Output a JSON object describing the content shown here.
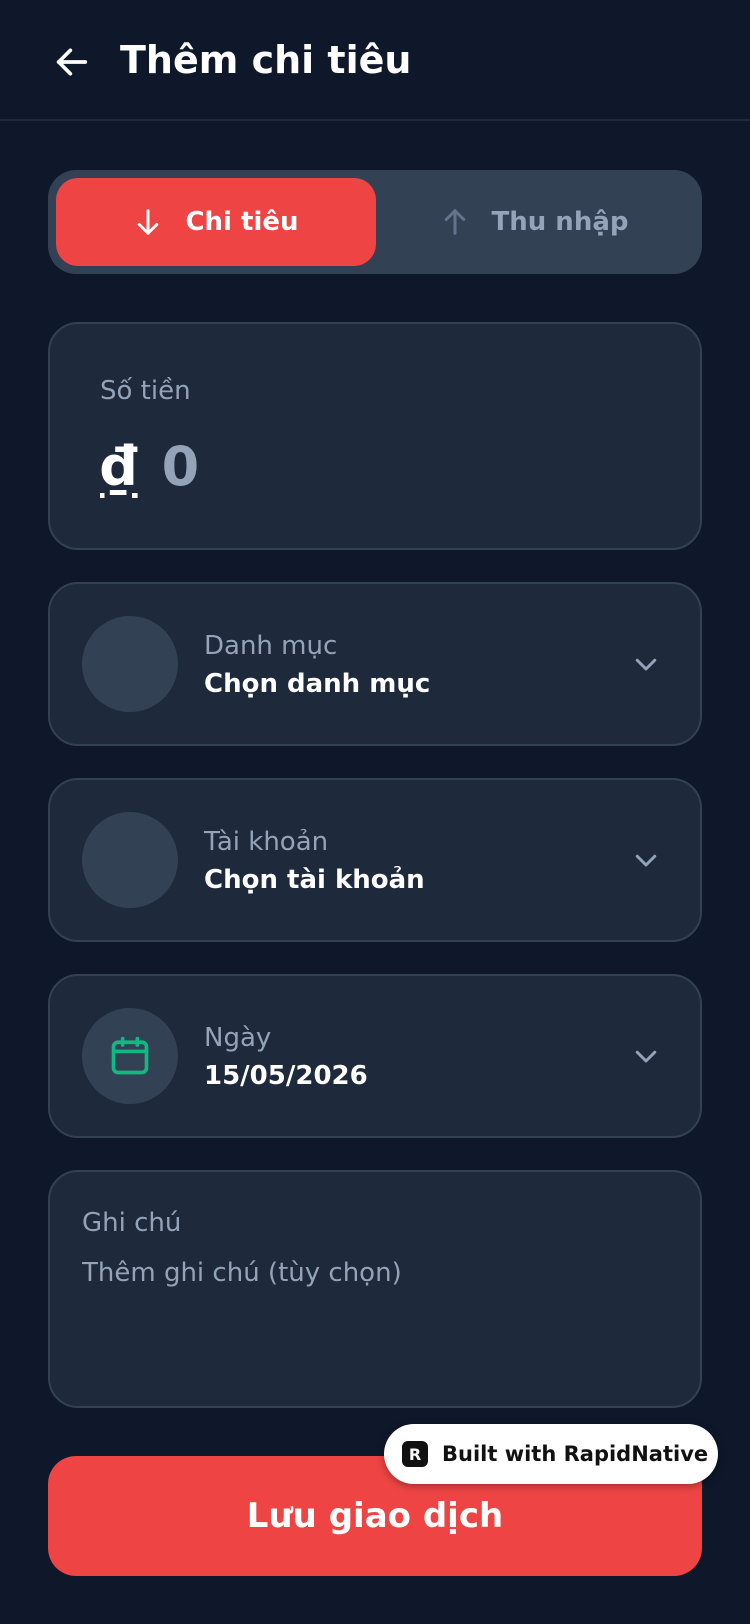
{
  "header": {
    "title": "Thêm chi tiêu"
  },
  "type_toggle": {
    "expense_label": "Chi tiêu",
    "income_label": "Thu nhập",
    "selected": "expense"
  },
  "amount": {
    "label": "Số tiền",
    "currency_symbol": "₫",
    "value": "0"
  },
  "category": {
    "label": "Danh mục",
    "value": "Chọn danh mục"
  },
  "account": {
    "label": "Tài khoản",
    "value": "Chọn tài khoản"
  },
  "date": {
    "label": "Ngày",
    "value": "15/05/2026"
  },
  "note": {
    "label": "Ghi chú",
    "placeholder": "Thêm ghi chú (tùy chọn)"
  },
  "save_button": {
    "label": "Lưu giao dịch"
  },
  "badge": {
    "text": "Built with RapidNative",
    "logo_letter": "R"
  },
  "colors": {
    "background": "#0f172a",
    "card": "#1e293b",
    "accent_red": "#ef4444",
    "muted": "#94a3b8",
    "calendar_green": "#10b981"
  },
  "icons": {
    "back": "arrow-left-icon",
    "expense": "arrow-down-icon",
    "income": "arrow-up-icon",
    "chevron": "chevron-down-icon",
    "date": "calendar-icon"
  }
}
